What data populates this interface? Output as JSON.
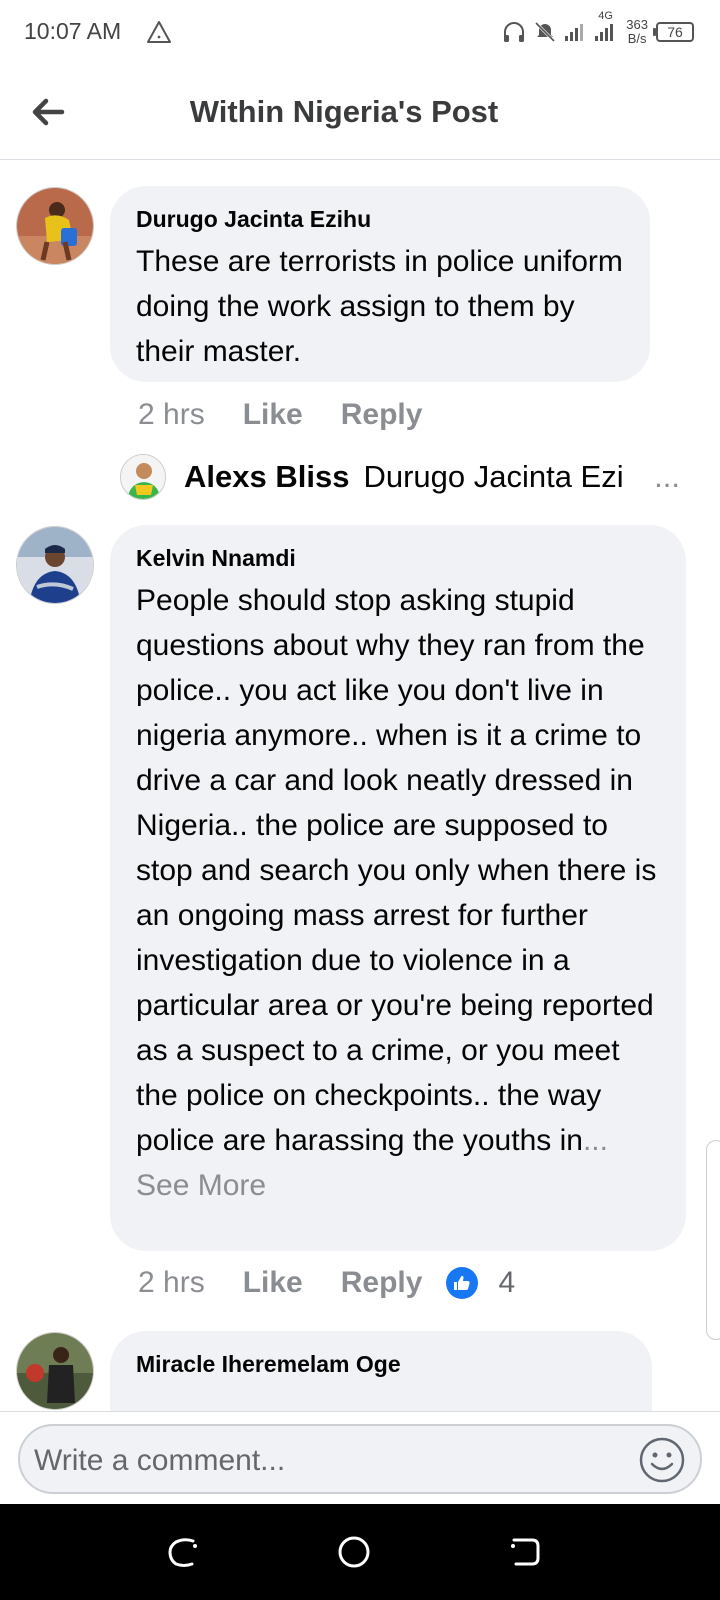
{
  "status_bar": {
    "time": "10:07 AM",
    "network": "4G",
    "speed_value": "363",
    "speed_unit": "B/s",
    "battery": "76"
  },
  "header": {
    "title": "Within Nigeria's Post"
  },
  "comments": [
    {
      "author": "Durugo Jacinta Ezihu",
      "text": "These are terrorists in police uniform doing the work assign to them by their master.",
      "time": "2 hrs",
      "like_label": "Like",
      "reply_label": "Reply"
    },
    {
      "author": "Kelvin Nnamdi",
      "text": "People should stop asking stupid questions about why they ran from the police.. you act like you don't live in nigeria anymore.. when is it a crime to drive a car and look neatly dressed in Nigeria..  the police are supposed to stop and search you only when there is an ongoing mass arrest for further investigation due to violence in a particular area or you're being reported as a suspect to a crime, or you meet the police on checkpoints.. the way police are harassing the youths in",
      "see_more": "... See More",
      "time": "2 hrs",
      "like_label": "Like",
      "reply_label": "Reply",
      "reaction_count": "4"
    },
    {
      "author": "Miracle Iheremelam Oge"
    }
  ],
  "reply_preview": {
    "author": "Alexs Bliss",
    "snippet": "Durugo Jacinta Ezi",
    "ellipsis": "..."
  },
  "composer": {
    "placeholder": "Write a comment..."
  },
  "colors": {
    "bubble_bg": "#f0f2f5",
    "like_blue": "#1877f2",
    "secondary_text": "#65676b"
  },
  "icons": {
    "back": "back-arrow-icon",
    "like_reaction": "thumbs-up-icon",
    "emoji": "smiley-icon"
  }
}
